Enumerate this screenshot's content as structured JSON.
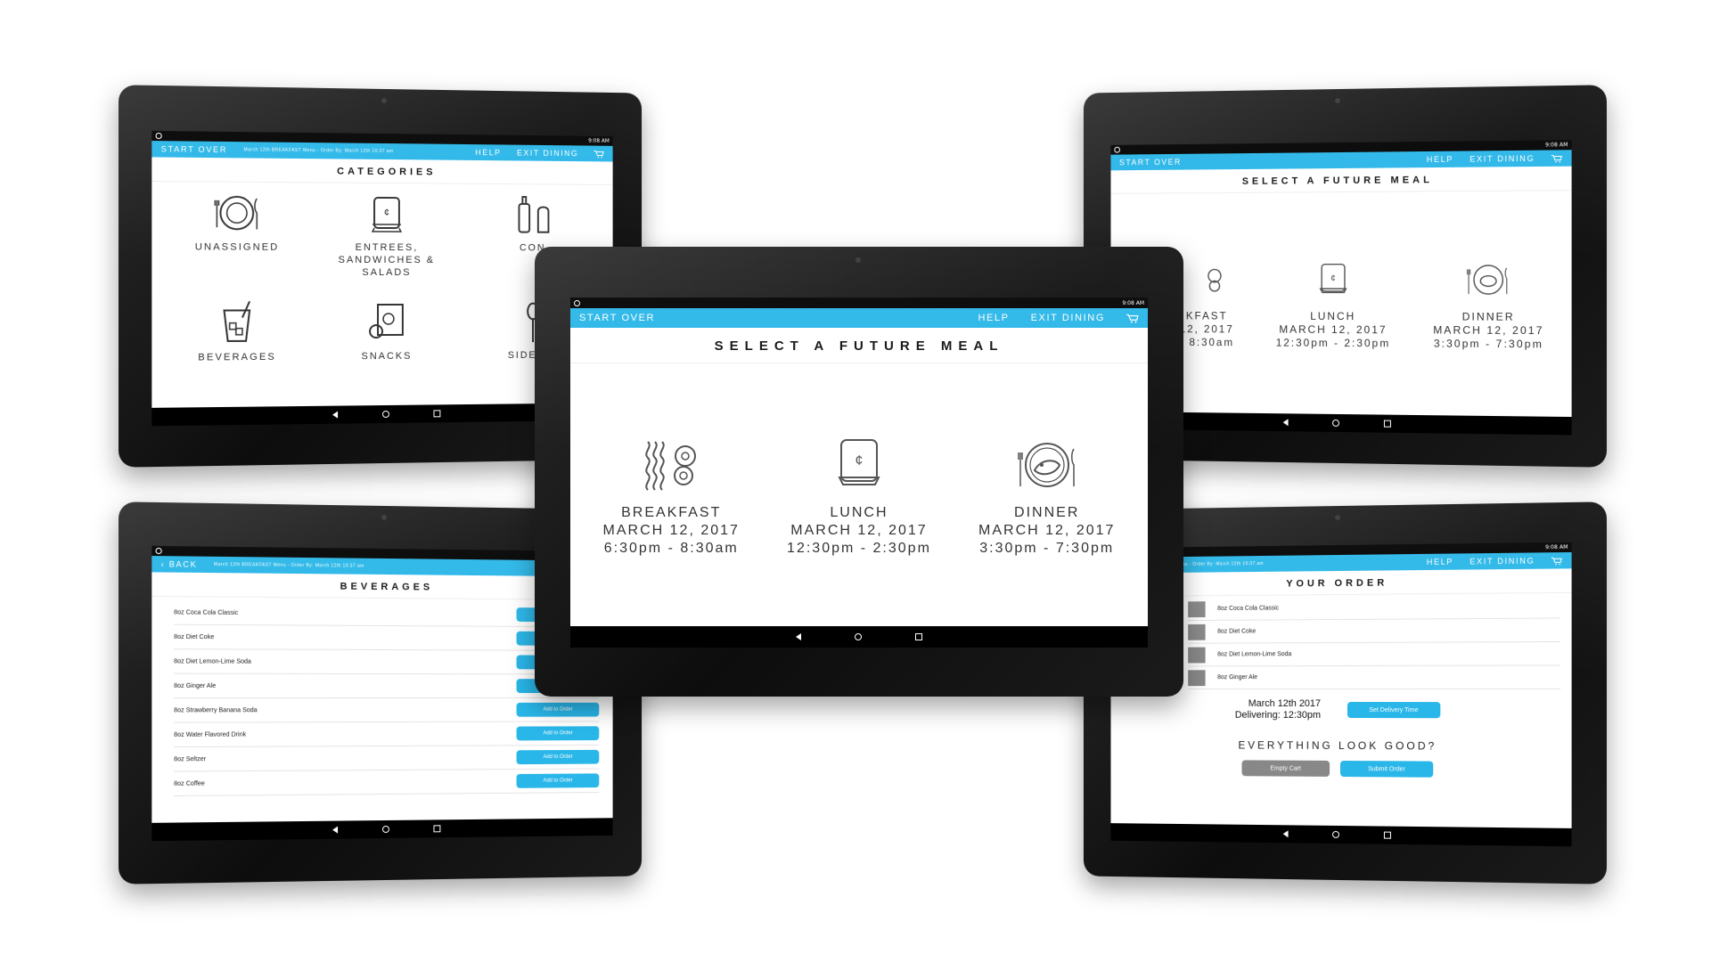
{
  "status": {
    "time": "9:08 AM"
  },
  "header": {
    "start_over": "START OVER",
    "back": "BACK",
    "help": "HELP",
    "exit_dining": "EXIT DINING",
    "subtitle": "March 12th BREAKFAST Menu - Order By: March 12th 10:37 am"
  },
  "categories_screen": {
    "title": "CATEGORIES",
    "items": [
      {
        "label": "UNASSIGNED",
        "icon": "plate-icon"
      },
      {
        "label": "ENTREES, SANDWICHES & SALADS",
        "icon": "sandwich-icon"
      },
      {
        "label": "CON",
        "icon": "condiments-icon"
      },
      {
        "label": "BEVERAGES",
        "icon": "glass-icon"
      },
      {
        "label": "SNACKS",
        "icon": "snacks-icon"
      },
      {
        "label": "SIDES &",
        "icon": "spoon-icon"
      }
    ]
  },
  "meal_screen": {
    "title": "SELECT A FUTURE MEAL",
    "meals": [
      {
        "name": "BREAKFAST",
        "date": "MARCH 12, 2017",
        "time": "6:30pm - 8:30am",
        "icon": "breakfast-icon"
      },
      {
        "name": "LUNCH",
        "date": "MARCH 12, 2017",
        "time": "12:30pm - 2:30pm",
        "icon": "lunch-icon"
      },
      {
        "name": "DINNER",
        "date": "MARCH 12, 2017",
        "time": "3:30pm - 7:30pm",
        "icon": "dinner-icon"
      }
    ],
    "partial_breakfast": {
      "name": "KFAST",
      "date": "12, 2017",
      "time": "- 8:30am"
    }
  },
  "beverages_screen": {
    "title": "BEVERAGES",
    "add_label": "Add to Order",
    "items": [
      "8oz Coca Cola Classic",
      "8oz Diet Coke",
      "8oz Diet Lemon-Lime Soda",
      "8oz Ginger Ale",
      "8oz Strawberry Banana Soda",
      "8oz Water Flavored Drink",
      "8oz Seltzer",
      "8oz Coffee"
    ]
  },
  "order_screen": {
    "title": "YOUR ORDER",
    "items": [
      "8oz Coca Cola Classic",
      "8oz Diet Coke",
      "8oz Diet Lemon-Lime Soda",
      "8oz Ginger Ale"
    ],
    "delivery_date": "March 12th 2017",
    "delivery_time": "Delivering: 12:30pm",
    "set_delivery": "Set Delivery Time",
    "confirm": "EVERYTHING LOOK GOOD?",
    "empty_cart": "Empty Cart",
    "submit": "Submit Order"
  },
  "colors": {
    "accent": "#29b6e8",
    "bezel": "#111111",
    "thumb": "#888888"
  }
}
